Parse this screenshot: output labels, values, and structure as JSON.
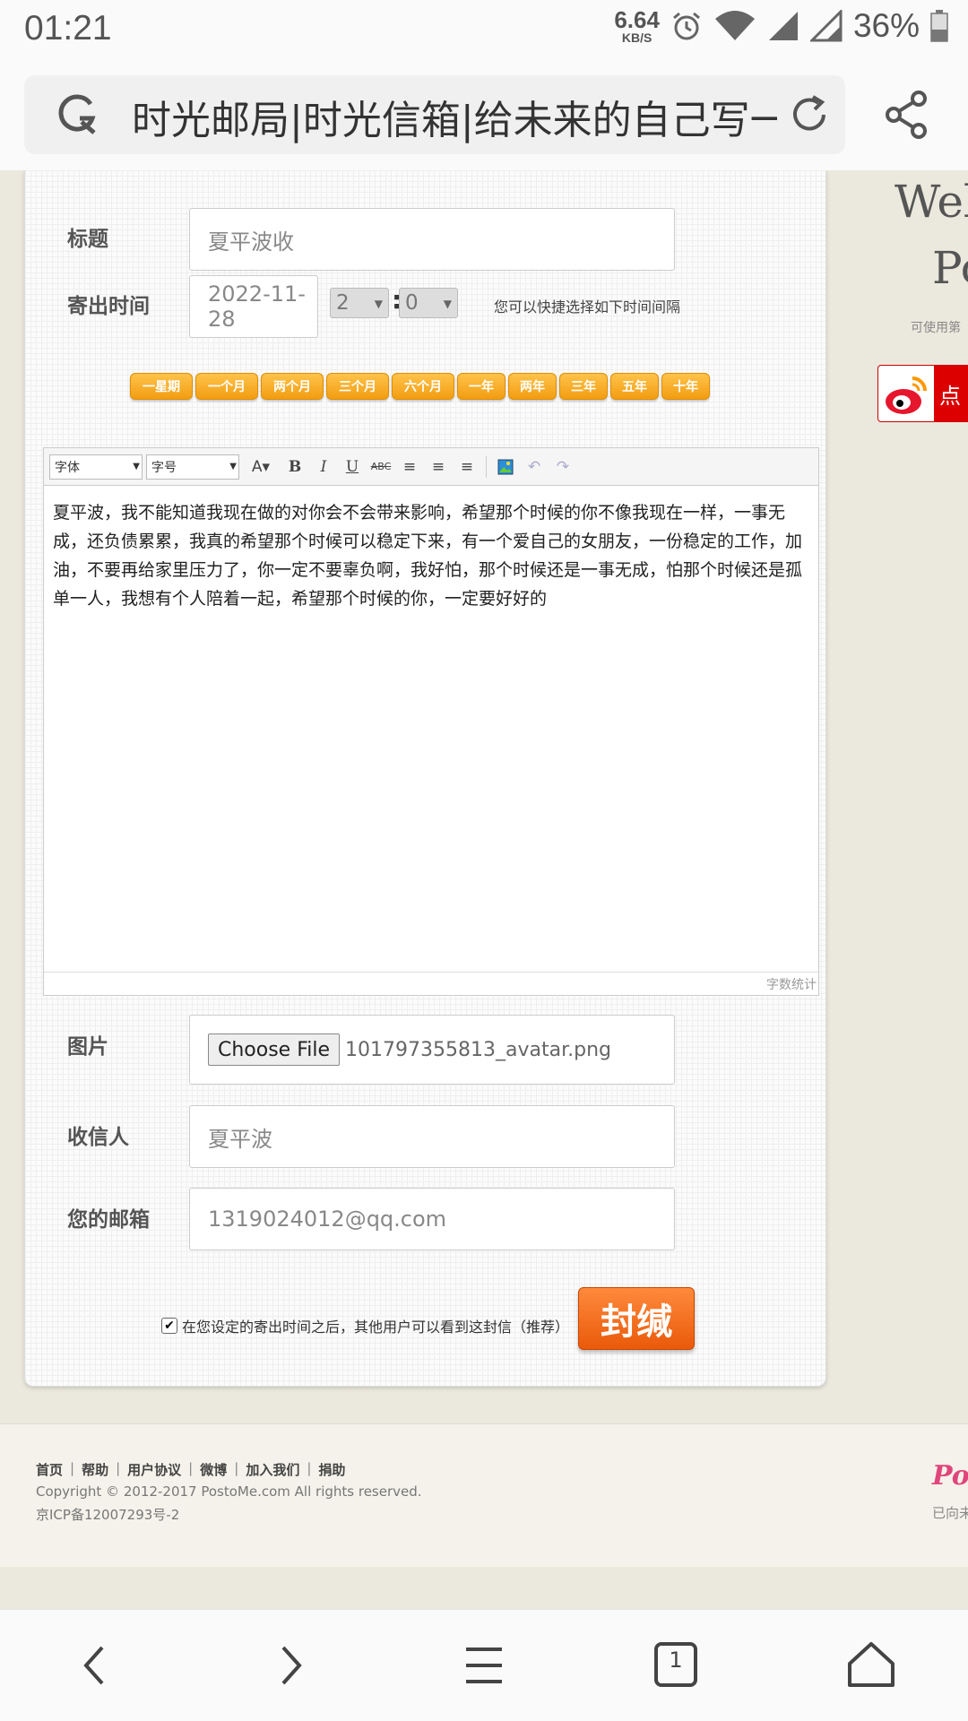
{
  "status_bar": {
    "time": "01:21",
    "net_speed": "6.64",
    "net_unit": "KB/S",
    "battery": "36%"
  },
  "browser": {
    "page_title": "时光邮局|时光信箱|给未来的自己写一"
  },
  "form": {
    "title_label": "标题",
    "title_value": "夏平波收",
    "send_time_label": "寄出时间",
    "send_date": "2022-11-28",
    "hour": "2",
    "minute": "0",
    "time_sep": ":",
    "quick_hint": "您可以快捷选择如下时间间隔",
    "quick_buttons": [
      "一星期",
      "一个月",
      "两个月",
      "三个月",
      "六个月",
      "一年",
      "两年",
      "三年",
      "五年",
      "十年"
    ],
    "editor": {
      "font_select": "字体",
      "size_select": "字号",
      "content": "夏平波，我不能知道我现在做的对你会不会带来影响，希望那个时候的你不像我现在一样，一事无成，还负债累累，我真的希望那个时候可以稳定下来，有一个爱自己的女朋友，一份稳定的工作，加油，不要再给家里压力了，你一定不要辜负啊，我好怕，那个时候还是一事无成，怕那个时候还是孤单一人，我想有个人陪着一起，希望那个时候的你，一定要好好的",
      "word_count": "字数统计"
    },
    "image_label": "图片",
    "choose_file": "Choose File",
    "file_name": "101797355813_avatar.png",
    "recipient_label": "收信人",
    "recipient_value": "夏平波",
    "email_label": "您的邮箱",
    "email_value": "1319024012@qq.com",
    "public_note": "在您设定的寄出时间之后，其他用户可以看到这封信（推荐）",
    "seal_button": "封缄"
  },
  "side": {
    "title_line1": "Wel",
    "title_line2": "Po",
    "hint": "可使用第",
    "weibo_text": "点"
  },
  "footer": {
    "links": [
      "首页",
      "帮助",
      "用户协议",
      "微博",
      "加入我们",
      "捐助"
    ],
    "separator": "|",
    "copyright": "Copyright © 2012-2017 PostoMe.com All rights reserved.",
    "icp": "京ICP备12007293号-2",
    "logo": "Po",
    "side_text": "已向未"
  },
  "nav": {
    "tab_count": "1"
  }
}
